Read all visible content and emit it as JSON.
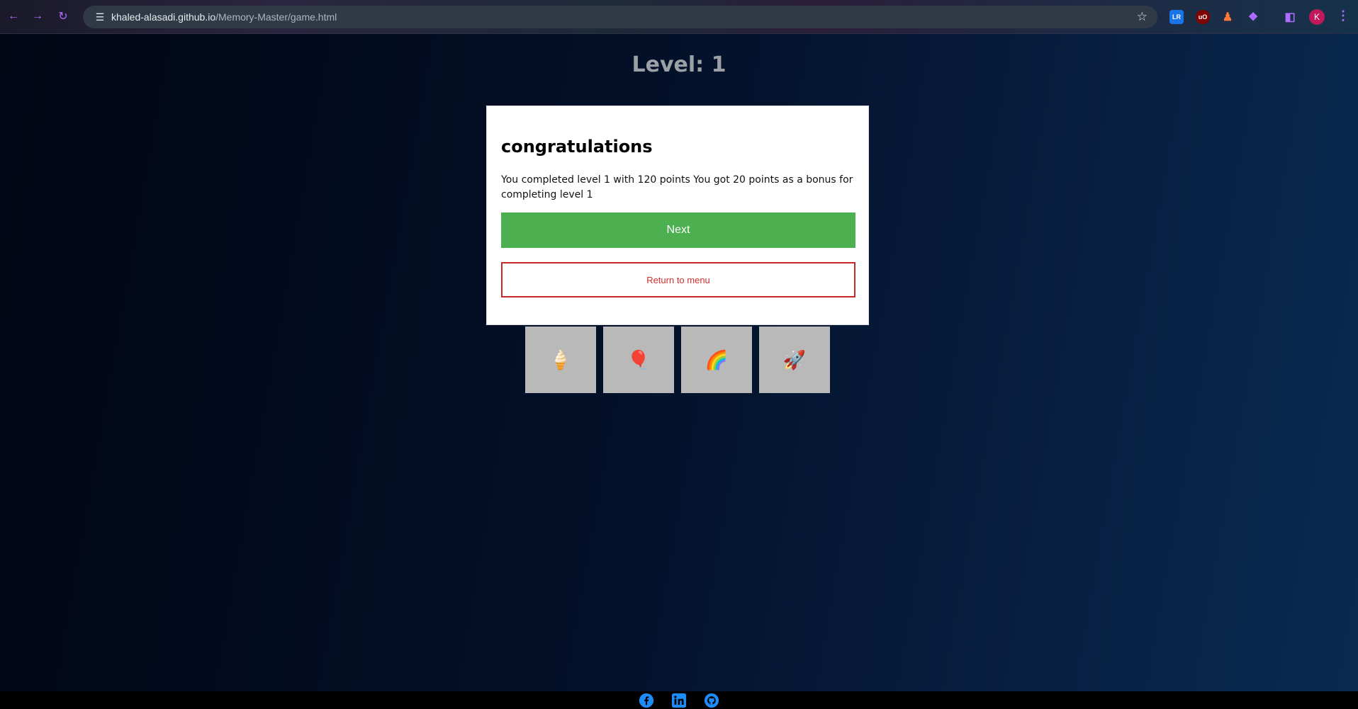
{
  "browser": {
    "url_host": "khaled-alasadi.github.io",
    "url_path": "/Memory-Master/game.html",
    "profile_initial": "K",
    "extensions": [
      "ublock-origin-icon",
      "extension-icon"
    ]
  },
  "game": {
    "level_label": "Level: 1",
    "cards": [
      {
        "icon": "ice-cream-icon",
        "glyph": "🍦"
      },
      {
        "icon": "balloon-icon",
        "glyph": "🎈"
      },
      {
        "icon": "rainbow-icon",
        "glyph": "🌈"
      },
      {
        "icon": "rocket-icon",
        "glyph": "🚀"
      }
    ]
  },
  "modal": {
    "title": "congratulations",
    "message": "You completed level 1 with 120 points You got 20 points as a bonus for completing level 1",
    "next_label": "Next",
    "menu_label": "Return to menu"
  },
  "footer": {
    "links": [
      "facebook-icon",
      "linkedin-icon",
      "github-icon"
    ]
  },
  "colors": {
    "next_button": "#4caf50",
    "menu_button_border": "#c62828",
    "social_icons": "#1d8cf8"
  }
}
